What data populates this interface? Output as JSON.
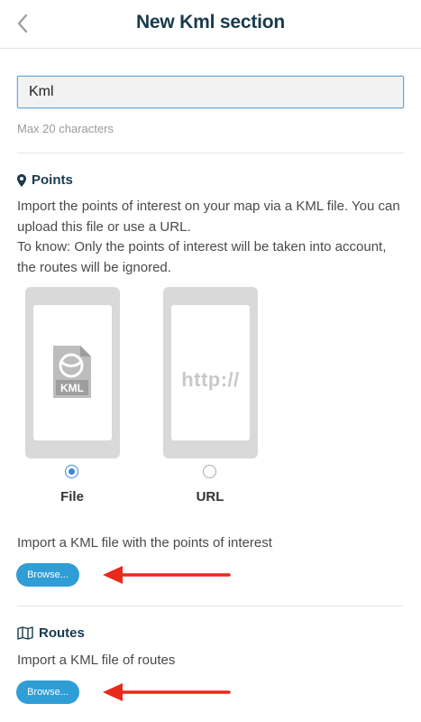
{
  "header": {
    "title": "New Kml section",
    "back_icon": "chevron-left-icon"
  },
  "name_field": {
    "value": "Kml",
    "hint": "Max 20 characters"
  },
  "points": {
    "icon": "map-marker-icon",
    "title": "Points",
    "description_line1": "Import the points of interest on your map via a KML file. You can upload this file or use a URL.",
    "description_line2": "To know: Only the points of interest will be taken into account, the routes will be ignored.",
    "options": [
      {
        "label": "File",
        "selected": true,
        "icon": "kml-file-icon",
        "icon_text": "KML"
      },
      {
        "label": "URL",
        "selected": false,
        "icon": "http-icon",
        "icon_text": "http://"
      }
    ],
    "file_prompt": "Import a KML file with the points of interest",
    "browse_label": "Browse..."
  },
  "routes": {
    "icon": "map-icon",
    "title": "Routes",
    "file_prompt": "Import a KML file of routes",
    "browse_label": "Browse..."
  },
  "colors": {
    "title": "#183a4d",
    "accent": "#2f9ed6",
    "arrow": "#e8291c",
    "radio": "#3a87d6"
  }
}
